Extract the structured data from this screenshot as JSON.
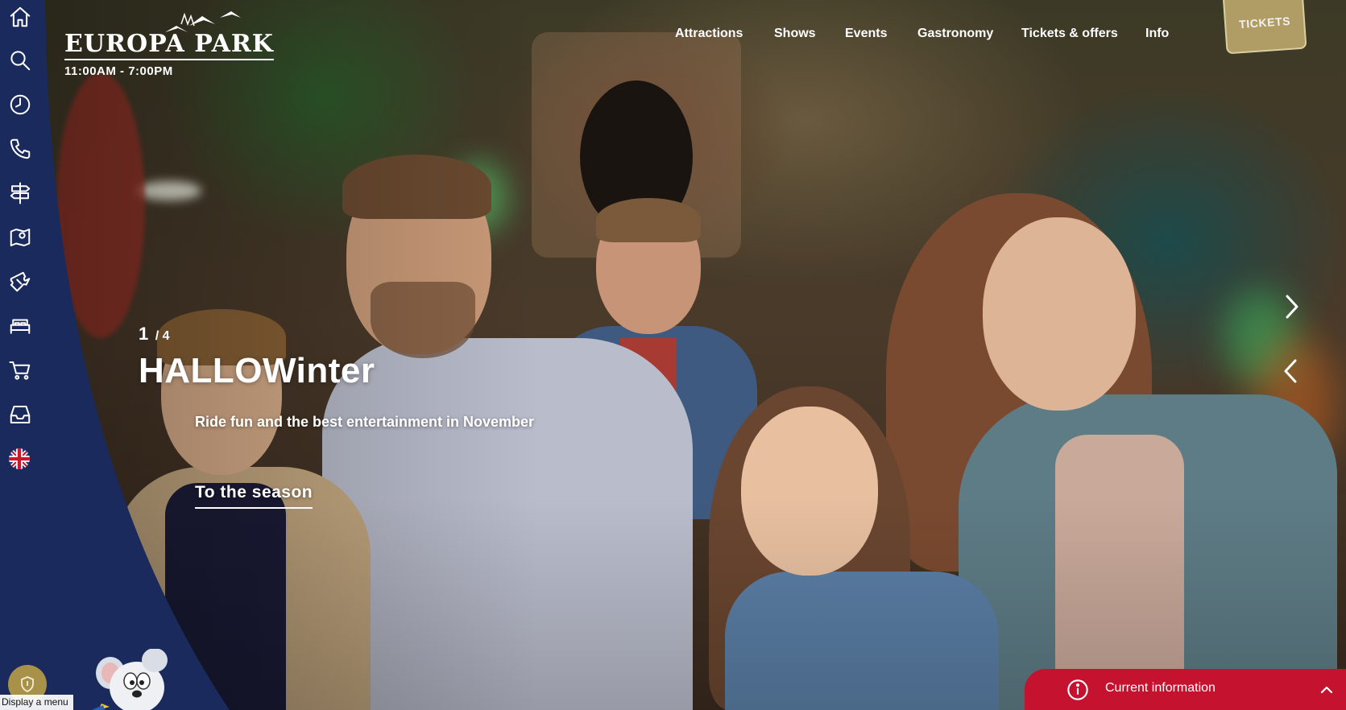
{
  "brand": {
    "logo_text": "EUROPA PARK",
    "opening_hours": "11:00AM - 7:00PM"
  },
  "sidebar": {
    "items": [
      {
        "icon": "home-icon"
      },
      {
        "icon": "search-icon"
      },
      {
        "icon": "clock-icon"
      },
      {
        "icon": "phone-icon"
      },
      {
        "icon": "signpost-icon"
      },
      {
        "icon": "map-icon"
      },
      {
        "icon": "ticket-icon"
      },
      {
        "icon": "bed-icon"
      },
      {
        "icon": "cart-icon"
      },
      {
        "icon": "inbox-icon"
      },
      {
        "icon": "uk-flag-icon"
      }
    ],
    "display_menu_label": "Display a menu"
  },
  "nav": {
    "items": [
      {
        "label": "Attractions"
      },
      {
        "label": "Shows"
      },
      {
        "label": "Events"
      },
      {
        "label": "Gastronomy"
      },
      {
        "label": "Tickets & offers"
      },
      {
        "label": "Info"
      }
    ],
    "tickets_label": "TICKETS"
  },
  "hero": {
    "slide_current": "1",
    "slide_total": "/ 4",
    "title": "HALLOWinter",
    "subtitle": "Ride fun and the best entertainment in November",
    "cta_label": "To the season"
  },
  "info_bar": {
    "label": "Current information"
  },
  "colors": {
    "sidebar": "#1b2a5c",
    "info_bar": "#c4122f",
    "tickets_gold": "#b9a46a",
    "text": "#ffffff"
  }
}
